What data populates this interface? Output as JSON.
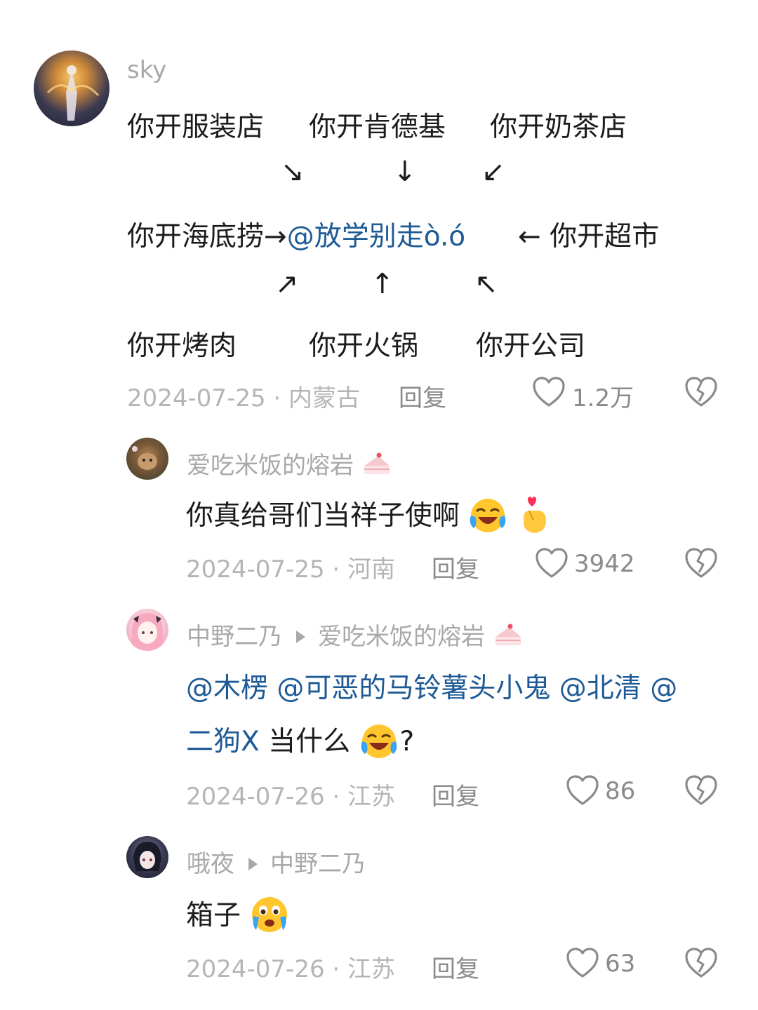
{
  "comments": [
    {
      "username": "sky",
      "grid": {
        "row1": [
          "你开服装店",
          "你开肯德基",
          "你开奶茶店"
        ],
        "arrows_top": [
          "↘",
          "↓",
          "↙"
        ],
        "row2_left": "你开海底捞→",
        "row2_mention": "@放学别走ò.ó",
        "row2_right": "← 你开超市",
        "arrows_bottom": [
          "↗",
          "↑",
          "↖"
        ],
        "row3": [
          "你开烤肉",
          "你开火锅",
          "你开公司"
        ]
      },
      "date": "2024-07-25",
      "location": "内蒙古",
      "reply_label": "回复",
      "likes": "1.2万"
    },
    {
      "username": "爱吃米饭的熔岩",
      "text": "你真给哥们当祥子使啊",
      "date": "2024-07-25",
      "location": "河南",
      "reply_label": "回复",
      "likes": "3942"
    },
    {
      "username": "中野二乃",
      "reply_to": "爱吃米饭的熔岩",
      "mentions_line1": "@木楞 @可恶的马铃薯头小鬼 @北清 @",
      "mentions_line2": "二狗X",
      "text_tail": " 当什么",
      "text_end": "?",
      "date": "2024-07-26",
      "location": "江苏",
      "reply_label": "回复",
      "likes": "86"
    },
    {
      "username": "哦夜",
      "reply_to": "中野二乃",
      "text": "箱子",
      "date": "2024-07-26",
      "location": "江苏",
      "reply_label": "回复",
      "likes": "63"
    }
  ],
  "meta_separator": " · ",
  "colors": {
    "mention": "#1e5a96",
    "username": "#a9a9a9",
    "meta": "#b5b5b5",
    "text": "#1c1c1c"
  }
}
